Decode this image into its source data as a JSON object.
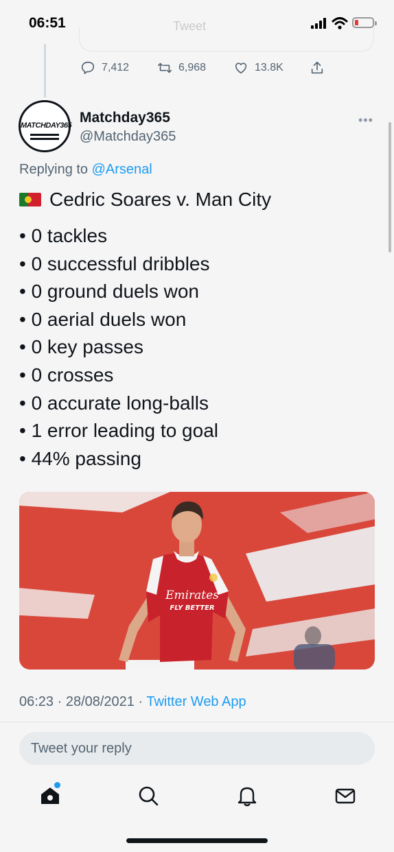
{
  "status_bar": {
    "time": "06:51",
    "faded_title": "Tweet"
  },
  "previous_tweet": {
    "replies": "7,412",
    "retweets": "6,968",
    "likes": "13.8K"
  },
  "tweet": {
    "avatar_text": "MATCHDAY365",
    "display_name": "Matchday365",
    "handle": "@Matchday365",
    "replying_to_prefix": "Replying to ",
    "replying_to_user": "@Arsenal",
    "flag_icon": "portugal-flag-icon",
    "headline": "Cedric Soares v. Man City",
    "stats": [
      "• 0 tackles",
      "• 0 successful dribbles",
      "• 0 ground duels won",
      "• 0 aerial duels won",
      "• 0 key passes",
      "• 0 crosses",
      "• 0 accurate long-balls",
      "• 1 error leading to goal",
      "• 44% passing"
    ],
    "photo": {
      "shirt_sponsor_line1": "Emirates",
      "shirt_sponsor_line2": "FLY BETTER"
    },
    "timestamp": "06:23 · 28/08/2021 · ",
    "source_app": "Twitter Web App"
  },
  "reply": {
    "placeholder": "Tweet your reply"
  },
  "colors": {
    "accent": "#1d9bf0",
    "text": "#0f1419",
    "secondary": "#536471",
    "background": "#f5f5f6"
  }
}
